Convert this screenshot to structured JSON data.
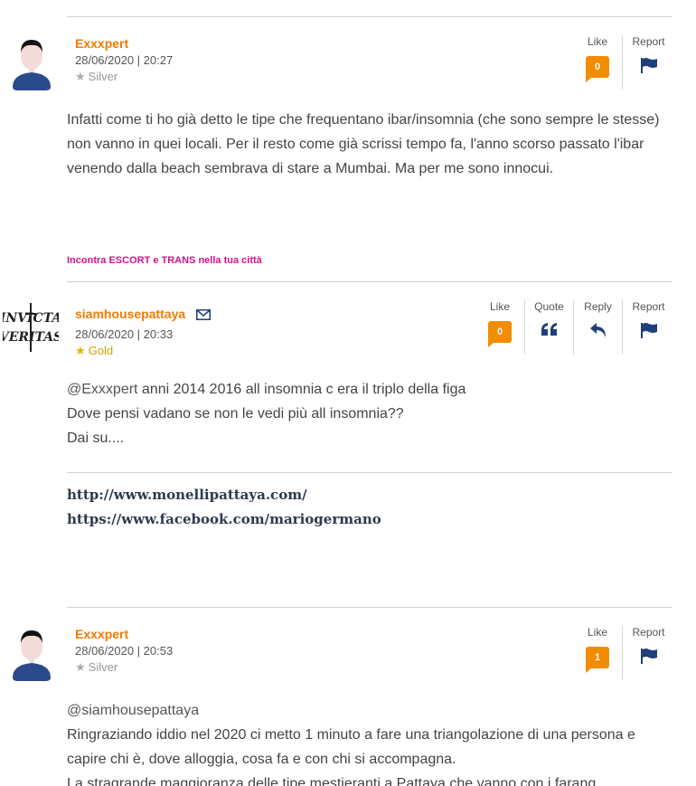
{
  "posts": [
    {
      "author": "Exxxpert",
      "date": "28/06/2020 | 20:27",
      "rank": "Silver",
      "like_label": "Like",
      "like_count": "0",
      "report_label": "Report",
      "text": "Infatti come ti ho già detto le tipe che frequentano ibar/insomnia (che sono sempre le stesse) non vanno in quei locali. Per il resto come già scrissi tempo fa, l'anno scorso passato l'ibar venendo dalla beach sembrava di stare a Mumbai. Ma per me sono innocui."
    },
    {
      "author": "siamhousepattaya",
      "date": "28/06/2020 | 20:33",
      "rank": "Gold",
      "like_label": "Like",
      "like_count": "0",
      "quote_label": "Quote",
      "reply_label": "Reply",
      "report_label": "Report",
      "mention": "@Exxxpert",
      "line1_rest": " anni 2014 2016 all insomnia c era il triplo della figa",
      "line2": "Dove pensi vadano se non le vedi più all insomnia??",
      "line3": "Dai su....",
      "signature": {
        "link1": "http://www.monellipattaya.com/",
        "link2": "https://www.facebook.com/mariogermano"
      },
      "logo_text": "INVICTA VERITAS"
    },
    {
      "author": "Exxxpert",
      "date": "28/06/2020 | 20:53",
      "rank": "Silver",
      "like_label": "Like",
      "like_count": "1",
      "report_label": "Report",
      "mention": "@siamhousepattaya",
      "line2": "Ringraziando iddio nel 2020 ci metto 1 minuto a fare una triangolazione di una persona e capire chi è, dove alloggia, cosa fa e con chi si accompagna.",
      "line3": "La stragrande maggioranza delle tipe mestieranti a Pattaya che vanno con i farang"
    }
  ],
  "sponsor_link": "Incontra ESCORT e TRANS nella tua città",
  "colors": {
    "author": "#f07c00",
    "like_badge": "#f28c00",
    "icon_blue": "#1f3f7a",
    "sponsor": "#d0148c",
    "gold": "#d4a20b"
  }
}
